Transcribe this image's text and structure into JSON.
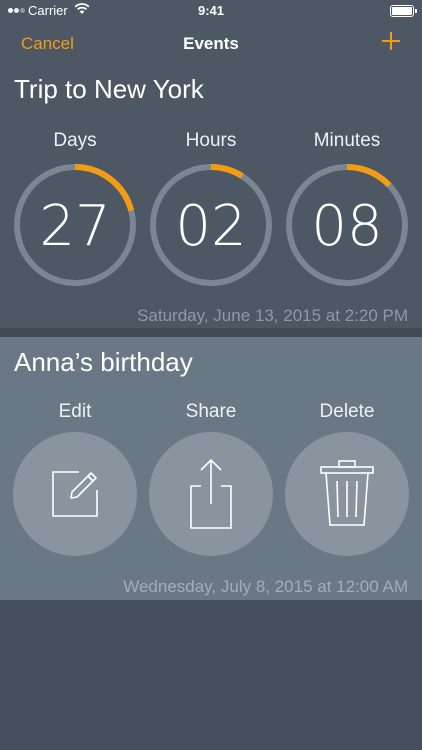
{
  "status_bar": {
    "carrier": "Carrier",
    "time": "9:41"
  },
  "nav": {
    "cancel_label": "Cancel",
    "title": "Events",
    "add_icon": "plus-icon"
  },
  "events": [
    {
      "title": "Trip to New York",
      "countdown": [
        {
          "label": "Days",
          "value": "27",
          "progress": 0.21
        },
        {
          "label": "Hours",
          "value": "02",
          "progress": 0.09
        },
        {
          "label": "Minutes",
          "value": "08",
          "progress": 0.13
        }
      ],
      "date": "Saturday, June 13, 2015 at 2:20 PM"
    },
    {
      "title": "Anna’s birthday",
      "actions": [
        {
          "label": "Edit",
          "icon": "pencil-square-icon"
        },
        {
          "label": "Share",
          "icon": "share-icon"
        },
        {
          "label": "Delete",
          "icon": "trash-icon"
        }
      ],
      "date": "Wednesday, July 8, 2015 at 12:00 AM"
    }
  ],
  "colors": {
    "accent": "#f39c12",
    "ring_track": "#7c8692",
    "card_primary": "#4e5864",
    "card_secondary": "#6a7784",
    "background": "#454f5b"
  }
}
